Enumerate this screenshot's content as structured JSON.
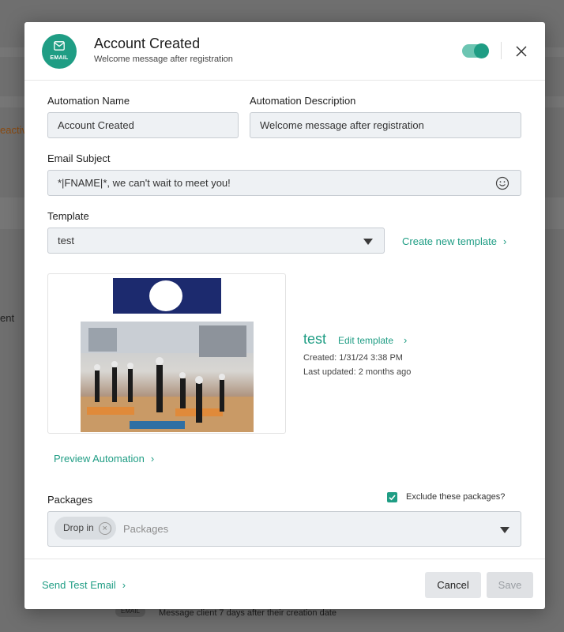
{
  "background": {
    "text_reactiv": "eactiv",
    "text_ent": "ent",
    "bottom_pill": "EMAIL",
    "bottom_text": "Message client 7 days after their creation date"
  },
  "header": {
    "icon_label": "EMAIL",
    "title": "Account Created",
    "subtitle": "Welcome message after registration",
    "enabled": true
  },
  "form": {
    "name_label": "Automation Name",
    "name_value": "Account Created",
    "description_label": "Automation Description",
    "description_value": "Welcome message after registration",
    "subject_label": "Email Subject",
    "subject_value": "*|FNAME|*, we can't wait to meet you!",
    "template_label": "Template",
    "template_value": "test",
    "create_template_link": "Create new template"
  },
  "template_preview": {
    "name": "test",
    "edit_link": "Edit template",
    "created": "Created: 1/31/24 3:38 PM",
    "last_updated": "Last updated: 2 months ago"
  },
  "preview_automation_link": "Preview Automation",
  "packages": {
    "label": "Packages",
    "exclude_label": "Exclude these packages?",
    "exclude_checked": true,
    "chips": [
      "Drop in"
    ],
    "placeholder": "Packages"
  },
  "footer": {
    "send_test_link": "Send Test Email",
    "cancel_label": "Cancel",
    "save_label": "Save"
  },
  "colors": {
    "accent": "#1f9d84",
    "field_bg": "#eef1f4",
    "overlay": "#6f6f6f"
  }
}
